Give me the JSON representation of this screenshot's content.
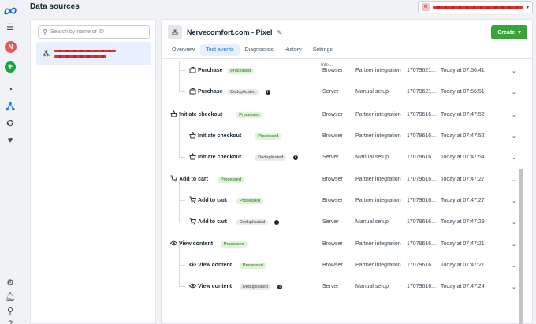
{
  "page": {
    "title": "Data sources"
  },
  "account": {
    "badge": "N",
    "chevron": "▾"
  },
  "rail": {
    "avatar_letter": "N",
    "plus": "+"
  },
  "search": {
    "placeholder": "Search by name or ID"
  },
  "pixel": {
    "name": "Nervecomfort.com - Pixel"
  },
  "create_button": {
    "label": "Create",
    "caret": "▾"
  },
  "tabs": [
    "Overview",
    "Test events",
    "Diagnostics",
    "History",
    "Settings"
  ],
  "active_tab": "Test events",
  "table": {
    "cut_header": "Inte..."
  },
  "events": [
    {
      "name": "Purchase",
      "icon": "purchase-icon",
      "badge": "Processed",
      "badge_type": "processed",
      "info": false,
      "source": "Browser",
      "setup": "Partner integration",
      "id": "17079621...",
      "time": "Today at 07:56:41",
      "level": 0
    },
    {
      "name": "Purchase",
      "icon": "purchase-icon",
      "badge": "Processed",
      "badge_type": "processed",
      "info": false,
      "source": "Browser",
      "setup": "Partner integration",
      "id": "17079621...",
      "time": "Today at 07:56:41",
      "level": 1
    },
    {
      "name": "Purchase",
      "icon": "purchase-icon",
      "badge": "Deduplicated",
      "badge_type": "dedup",
      "info": true,
      "source": "Server",
      "setup": "Manual setup",
      "id": "17079621...",
      "time": "Today at 07:56:51",
      "level": 1
    },
    {
      "name": "Initiate checkout",
      "icon": "basket-icon",
      "badge": "Processed",
      "badge_type": "processed",
      "info": false,
      "source": "Browser",
      "setup": "Partner integration",
      "id": "17079616...",
      "time": "Today at 07:47:52",
      "level": 0
    },
    {
      "name": "Initiate checkout",
      "icon": "basket-icon",
      "badge": "Processed",
      "badge_type": "processed",
      "info": false,
      "source": "Browser",
      "setup": "Partner integration",
      "id": "17079616...",
      "time": "Today at 07:47:52",
      "level": 1
    },
    {
      "name": "Initiate checkout",
      "icon": "basket-icon",
      "badge": "Deduplicated",
      "badge_type": "dedup",
      "info": true,
      "source": "Server",
      "setup": "Manual setup",
      "id": "17079616...",
      "time": "Today at 07:47:54",
      "level": 1
    },
    {
      "name": "Add to cart",
      "icon": "cart-icon",
      "badge": "Processed",
      "badge_type": "processed",
      "info": false,
      "source": "Browser",
      "setup": "Partner integration",
      "id": "17079616...",
      "time": "Today at 07:47:27",
      "level": 0
    },
    {
      "name": "Add to cart",
      "icon": "cart-icon",
      "badge": "Processed",
      "badge_type": "processed",
      "info": false,
      "source": "Browser",
      "setup": "Partner integration",
      "id": "17079616...",
      "time": "Today at 07:47:27",
      "level": 1
    },
    {
      "name": "Add to cart",
      "icon": "cart-icon",
      "badge": "Deduplicated",
      "badge_type": "dedup",
      "info": true,
      "source": "Server",
      "setup": "Manual setup",
      "id": "17079616...",
      "time": "Today at 07:47:29",
      "level": 1
    },
    {
      "name": "View content",
      "icon": "eye-icon",
      "badge": "Processed",
      "badge_type": "processed",
      "info": false,
      "source": "Browser",
      "setup": "Partner integration",
      "id": "17079616...",
      "time": "Today at 07:47:21",
      "level": 0
    },
    {
      "name": "View content",
      "icon": "eye-icon",
      "badge": "Processed",
      "badge_type": "processed",
      "info": false,
      "source": "Browser",
      "setup": "Partner integration",
      "id": "17079616...",
      "time": "Today at 07:47:21",
      "level": 1
    },
    {
      "name": "View content",
      "icon": "eye-icon",
      "badge": "Deduplicated",
      "badge_type": "dedup",
      "info": true,
      "source": "Server",
      "setup": "Manual setup",
      "id": "17079616...",
      "time": "Today at 07:47:24",
      "level": 1
    }
  ],
  "colors": {
    "accent": "#1877f2",
    "create_green": "#3aa33a",
    "processed_bg": "#dff3d6",
    "dedup_bg": "#e9eaec",
    "avatar_red": "#e05a5a"
  }
}
